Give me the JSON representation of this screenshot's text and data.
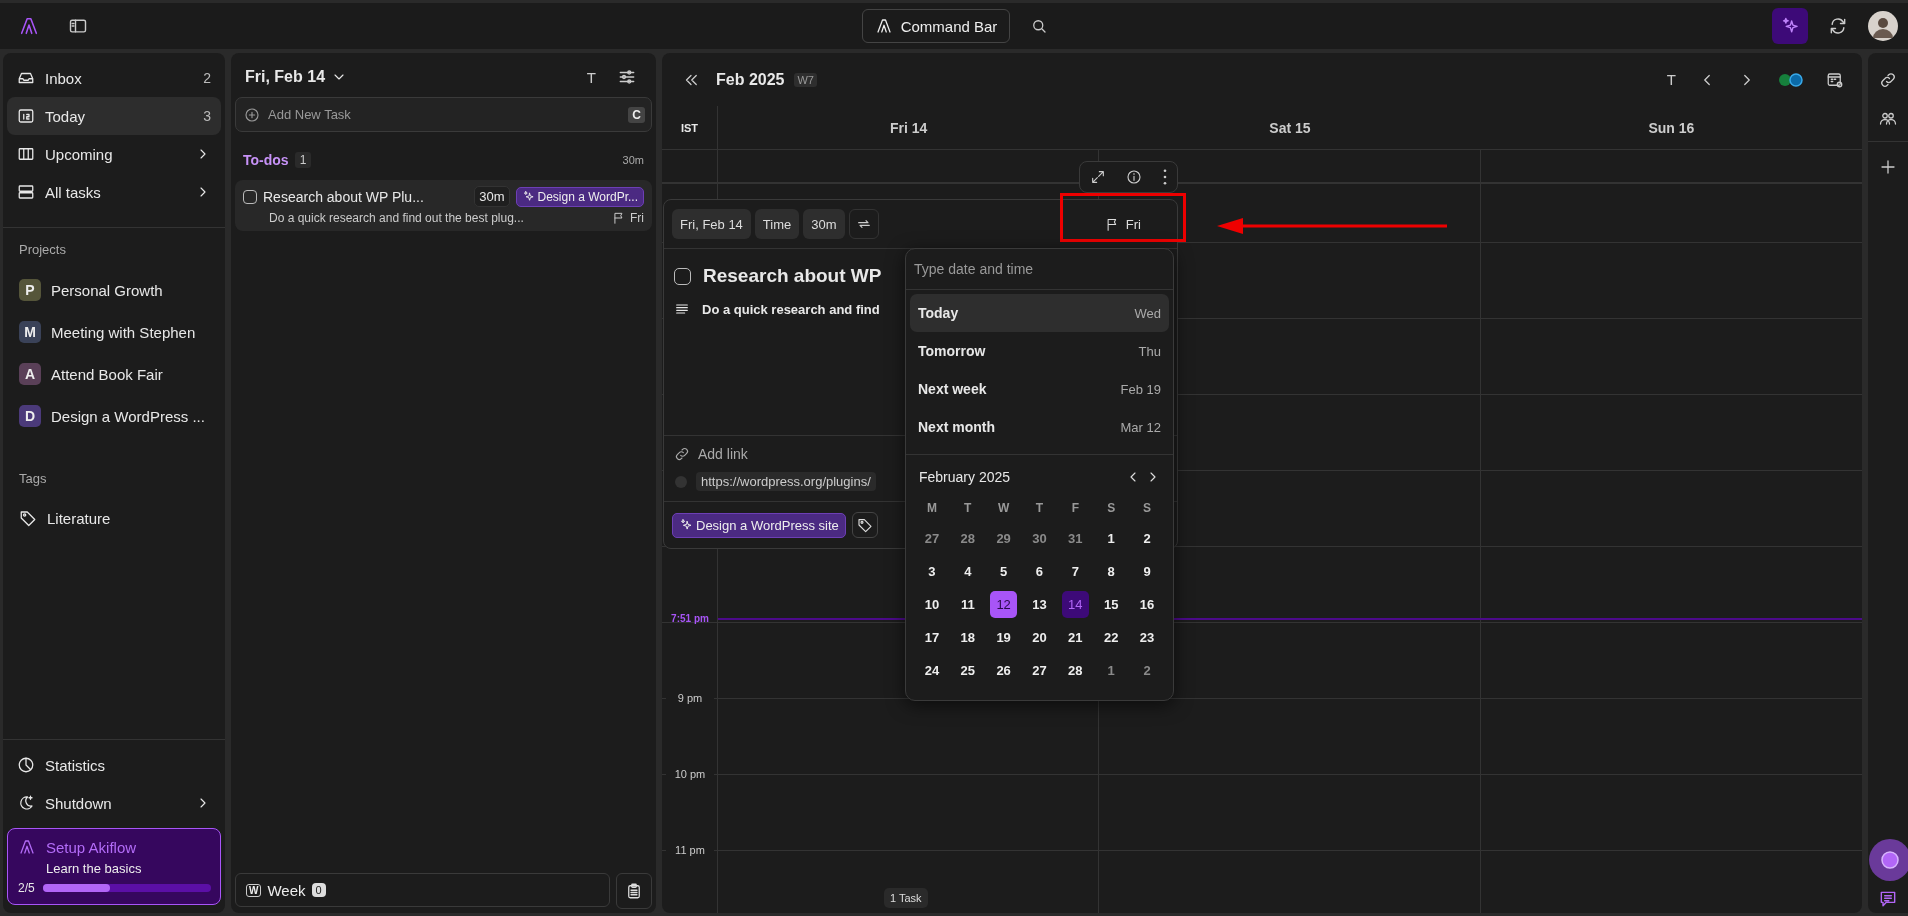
{
  "topbar": {
    "command_bar": "Command Bar"
  },
  "sidebar": {
    "nav": [
      {
        "label": "Inbox",
        "count": "2",
        "selected": false,
        "submenu": false
      },
      {
        "label": "Today",
        "count": "3",
        "selected": true,
        "submenu": false
      },
      {
        "label": "Upcoming",
        "selected": false,
        "submenu": true
      },
      {
        "label": "All tasks",
        "selected": false,
        "submenu": true
      }
    ],
    "projects_heading": "Projects",
    "projects": [
      {
        "letter": "P",
        "name": "Personal Growth",
        "color": "#55553a"
      },
      {
        "letter": "M",
        "name": "Meeting with Stephen",
        "color": "#3a4258"
      },
      {
        "letter": "A",
        "name": "Attend Book Fair",
        "color": "#5a4058"
      },
      {
        "letter": "D",
        "name": "Design a WordPress ...",
        "color": "#4b3a7a"
      }
    ],
    "tags_heading": "Tags",
    "tags": [
      {
        "name": "Literature"
      }
    ],
    "footer": [
      {
        "label": "Statistics",
        "submenu": false
      },
      {
        "label": "Shutdown",
        "submenu": true
      }
    ],
    "setup": {
      "title": "Setup Akiflow",
      "subtitle": "Learn the basics",
      "progress": "2/5",
      "level": 0.4
    }
  },
  "tasks_panel": {
    "date": "Fri, Feb 14",
    "view_letter": "T",
    "add_placeholder": "Add New Task",
    "shortcut": "C",
    "section": {
      "title": "To-dos",
      "count": "1",
      "duration": "30m"
    },
    "tasks": [
      {
        "title": "Research about WP Plu...",
        "duration": "30m",
        "project": "Design a WordPr...",
        "description": "Do a quick research and find out the best plug...",
        "due": "Fri",
        "checked": false
      }
    ],
    "week": {
      "key": "W",
      "label": "Week",
      "count": "0"
    }
  },
  "calendar": {
    "month": "Feb 2025",
    "week": "W7",
    "view_letter": "T",
    "timezone": "IST",
    "days": [
      "Fri 14",
      "Sat 15",
      "Sun 16"
    ],
    "hour_labels": [
      "9 pm",
      "10 pm",
      "11 pm"
    ],
    "now": "7:51 pm",
    "footer_badge": "1 Task",
    "calendars_on": true
  },
  "task_detail": {
    "chips": [
      "Fri, Feb 14",
      "Time",
      "30m"
    ],
    "due": "Fri",
    "checked": false,
    "title": "Research about WP",
    "description": "Do a quick research and find",
    "add_link": "Add link",
    "url": "https://wordpress.org/plugins/",
    "project": "Design a WordPress site"
  },
  "date_picker": {
    "placeholder": "Type date and time",
    "options": [
      {
        "label": "Today",
        "hint": "Wed",
        "selected": true
      },
      {
        "label": "Tomorrow",
        "hint": "Thu",
        "selected": false
      },
      {
        "label": "Next week",
        "hint": "Feb 19",
        "selected": false
      },
      {
        "label": "Next month",
        "hint": "Mar 12",
        "selected": false
      }
    ],
    "month": "February 2025",
    "weekdays": [
      "M",
      "T",
      "W",
      "T",
      "F",
      "S",
      "S"
    ],
    "weeks": [
      [
        {
          "day": "27",
          "outside": true,
          "today": false,
          "selected": false
        },
        {
          "day": "28",
          "outside": true,
          "today": false,
          "selected": false
        },
        {
          "day": "29",
          "outside": true,
          "today": false,
          "selected": false
        },
        {
          "day": "30",
          "outside": true,
          "today": false,
          "selected": false
        },
        {
          "day": "31",
          "outside": true,
          "today": false,
          "selected": false
        },
        {
          "day": "1",
          "outside": false,
          "today": false,
          "selected": false
        },
        {
          "day": "2",
          "outside": false,
          "today": false,
          "selected": false
        }
      ],
      [
        {
          "day": "3",
          "outside": false,
          "today": false,
          "selected": false
        },
        {
          "day": "4",
          "outside": false,
          "today": false,
          "selected": false
        },
        {
          "day": "5",
          "outside": false,
          "today": false,
          "selected": false
        },
        {
          "day": "6",
          "outside": false,
          "today": false,
          "selected": false
        },
        {
          "day": "7",
          "outside": false,
          "today": false,
          "selected": false
        },
        {
          "day": "8",
          "outside": false,
          "today": false,
          "selected": false
        },
        {
          "day": "9",
          "outside": false,
          "today": false,
          "selected": false
        }
      ],
      [
        {
          "day": "10",
          "outside": false,
          "today": false,
          "selected": false
        },
        {
          "day": "11",
          "outside": false,
          "today": false,
          "selected": false
        },
        {
          "day": "12",
          "outside": false,
          "today": true,
          "selected": false
        },
        {
          "day": "13",
          "outside": false,
          "today": false,
          "selected": false
        },
        {
          "day": "14",
          "outside": false,
          "today": false,
          "selected": true
        },
        {
          "day": "15",
          "outside": false,
          "today": false,
          "selected": false
        },
        {
          "day": "16",
          "outside": false,
          "today": false,
          "selected": false
        }
      ],
      [
        {
          "day": "17",
          "outside": false,
          "today": false,
          "selected": false
        },
        {
          "day": "18",
          "outside": false,
          "today": false,
          "selected": false
        },
        {
          "day": "19",
          "outside": false,
          "today": false,
          "selected": false
        },
        {
          "day": "20",
          "outside": false,
          "today": false,
          "selected": false
        },
        {
          "day": "21",
          "outside": false,
          "today": false,
          "selected": false
        },
        {
          "day": "22",
          "outside": false,
          "today": false,
          "selected": false
        },
        {
          "day": "23",
          "outside": false,
          "today": false,
          "selected": false
        }
      ],
      [
        {
          "day": "24",
          "outside": false,
          "today": false,
          "selected": false
        },
        {
          "day": "25",
          "outside": false,
          "today": false,
          "selected": false
        },
        {
          "day": "26",
          "outside": false,
          "today": false,
          "selected": false
        },
        {
          "day": "27",
          "outside": false,
          "today": false,
          "selected": false
        },
        {
          "day": "28",
          "outside": false,
          "today": false,
          "selected": false
        },
        {
          "day": "1",
          "outside": true,
          "today": false,
          "selected": false
        },
        {
          "day": "2",
          "outside": true,
          "today": false,
          "selected": false
        }
      ]
    ]
  }
}
